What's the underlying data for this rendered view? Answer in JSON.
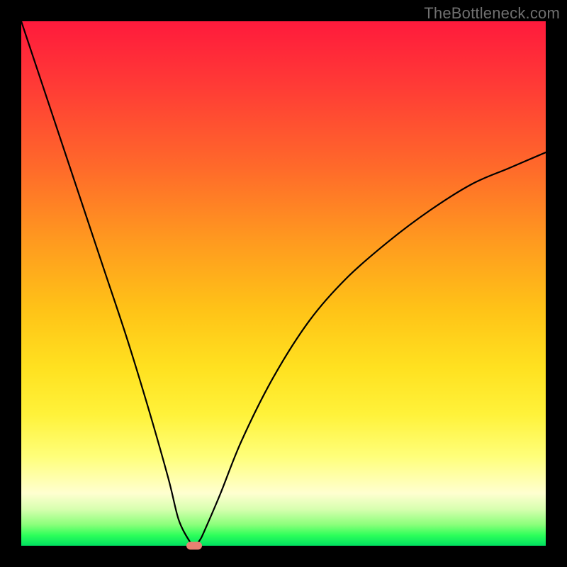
{
  "watermark": "TheBottleneck.com",
  "chart_data": {
    "type": "line",
    "title": "",
    "xlabel": "",
    "ylabel": "",
    "xlim": [
      0,
      100
    ],
    "ylim": [
      0,
      100
    ],
    "grid": false,
    "legend": false,
    "background_gradient": {
      "direction": "vertical",
      "stops": [
        {
          "pct": 0,
          "color": "#ff1a3c",
          "meaning": "severe bottleneck"
        },
        {
          "pct": 50,
          "color": "#ffc317",
          "meaning": "moderate"
        },
        {
          "pct": 90,
          "color": "#ffffd0",
          "meaning": "light"
        },
        {
          "pct": 100,
          "color": "#00e060",
          "meaning": "no bottleneck"
        }
      ]
    },
    "series": [
      {
        "name": "bottleneck-curve",
        "x": [
          0,
          4,
          8,
          12,
          16,
          20,
          24,
          28,
          30,
          32,
          33,
          34,
          35,
          38,
          42,
          48,
          55,
          62,
          70,
          78,
          86,
          93,
          100
        ],
        "y": [
          100,
          88,
          76,
          64,
          52,
          40,
          27,
          13,
          5,
          1,
          0,
          1,
          3,
          10,
          20,
          32,
          43,
          51,
          58,
          64,
          69,
          72,
          75
        ]
      }
    ],
    "marker": {
      "name": "optimal-point",
      "x": 33,
      "y": 0,
      "color": "#e98072"
    }
  }
}
